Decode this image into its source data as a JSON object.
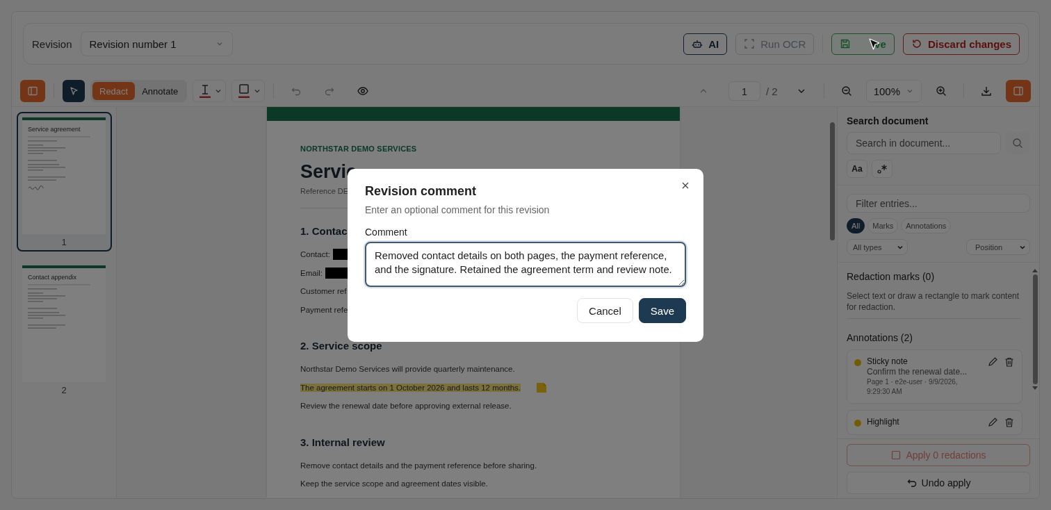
{
  "revision_bar": {
    "label": "Revision",
    "select_value": "Revision number 1",
    "buttons": [
      {
        "kind": "ai",
        "label": "AI",
        "disabled": false
      },
      {
        "kind": "ocr",
        "label": "Run OCR",
        "disabled": true
      },
      {
        "kind": "save",
        "label": "ve",
        "disabled": false
      },
      {
        "kind": "discard",
        "label": "Discard changes",
        "disabled": false
      }
    ]
  },
  "toolbar": {
    "sidebar_toggle": {
      "on": true
    },
    "select_tool": {
      "selected": true
    },
    "modes": [
      {
        "label": "Redact",
        "selected": true
      },
      {
        "label": "Annotate",
        "selected": false
      }
    ],
    "page_input": "1",
    "page_total": "/ 2",
    "zoom": "100%",
    "panel_toggle": {
      "on": true
    }
  },
  "thumbnails": [
    {
      "title": "Service agreement",
      "number": "1",
      "selected": true,
      "signature": true
    },
    {
      "title": "Contact appendix",
      "number": "2",
      "selected": false,
      "signature": false
    }
  ],
  "document": {
    "organization": "NORTHSTAR DEMO SERVICES",
    "title": "Servic",
    "reference": "Reference DE",
    "sections": [
      {
        "heading": "1. Contac",
        "lines": [
          {
            "text": "Contact:",
            "redacted": true,
            "highlighted": false,
            "note": false
          },
          {
            "text": "Email:",
            "redacted": true,
            "highlighted": false,
            "note": false
          },
          {
            "text": "Customer ref",
            "redacted": false,
            "highlighted": false,
            "note": false
          },
          {
            "text": "Payment refe",
            "redacted": false,
            "highlighted": false,
            "note": false
          }
        ]
      },
      {
        "heading": "2. Service scope",
        "lines": [
          {
            "text": "Northstar Demo Services will provide quarterly maintenance.",
            "redacted": false,
            "highlighted": false,
            "note": false
          },
          {
            "text": "The agreement starts on 1 October 2026 and lasts 12 months.",
            "redacted": false,
            "highlighted": true,
            "note": true
          },
          {
            "text": "Review the renewal date before approving external release.",
            "redacted": false,
            "highlighted": false,
            "note": false
          }
        ]
      },
      {
        "heading": "3. Internal review",
        "lines": [
          {
            "text": "Remove contact details and the payment reference before sharing.",
            "redacted": false,
            "highlighted": false,
            "note": false
          },
          {
            "text": "Keep the service scope and agreement dates visible.",
            "redacted": false,
            "highlighted": false,
            "note": false
          }
        ]
      }
    ]
  },
  "side_panel": {
    "search_title": "Search document",
    "search_placeholder": "Search in document...",
    "case_option": "Aa",
    "filter_placeholder": "Filter entries...",
    "chips": [
      {
        "label": "All",
        "selected": true
      },
      {
        "label": "Marks",
        "selected": false
      },
      {
        "label": "Annotations",
        "selected": false
      }
    ],
    "type_select": "All types",
    "sort_select": "Position",
    "redaction_title": "Redaction marks (0)",
    "redaction_hint": "Select text or draw a rectangle to mark content for redaction.",
    "annotations_title": "Annotations (2)",
    "annotations": [
      {
        "title": "Sticky note",
        "text": "Confirm the renewal date...",
        "meta": "Page 1 · e2e-user · 9/9/2026, 9:29:30 AM"
      },
      {
        "title": "Highlight"
      }
    ],
    "apply_button": {
      "label": "Apply 0 redactions",
      "disabled": true
    },
    "undo_button": "Undo apply"
  },
  "dialog": {
    "title": "Revision comment",
    "subtitle": "Enter an optional comment for this revision",
    "field_label": "Comment",
    "comment": "Removed contact details on both pages, the payment reference, and the signature. Retained the agreement term and review note.",
    "buttons": [
      {
        "kind": "secondary",
        "label": "Cancel"
      },
      {
        "kind": "primary",
        "label": "Save"
      }
    ]
  }
}
